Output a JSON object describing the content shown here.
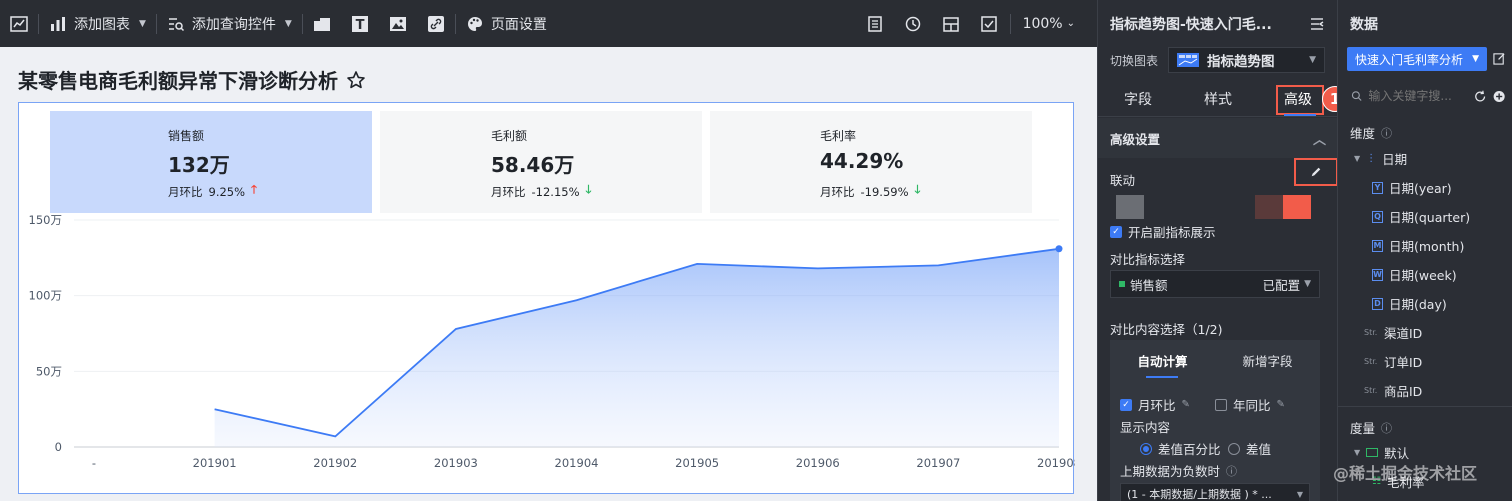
{
  "toolbar": {
    "add_chart": "添加图表",
    "add_query": "添加查询控件",
    "page_settings": "页面设置",
    "zoom": "100%"
  },
  "dashboard": {
    "title": "某零售电商毛利额异常下滑诊断分析",
    "kpis": [
      {
        "title": "销售额",
        "value": "132万",
        "cmp_label": "月环比",
        "cmp_value": "9.25%",
        "direction": "up"
      },
      {
        "title": "毛利额",
        "value": "58.46万",
        "cmp_label": "月环比",
        "cmp_value": "-12.15%",
        "direction": "down"
      },
      {
        "title": "毛利率",
        "value": "44.29%",
        "cmp_label": "月环比",
        "cmp_value": "-19.59%",
        "direction": "down"
      }
    ],
    "chart_data": {
      "type": "area",
      "categories": [
        "-",
        "201901",
        "201902",
        "201903",
        "201904",
        "201905",
        "201906",
        "201907",
        "201908"
      ],
      "x": [
        "201901",
        "201902",
        "201903",
        "201904",
        "201905",
        "201906",
        "201907",
        "201908"
      ],
      "values": [
        25,
        7,
        78,
        97,
        121,
        118,
        120,
        131
      ],
      "yticks": [
        "0",
        "50万",
        "100万",
        "150万"
      ],
      "ylim": [
        0,
        150
      ],
      "y_unit": "万",
      "color": "#3d7bf5"
    }
  },
  "settings": {
    "header": "指标趋势图-快速入门毛...",
    "switch_label": "切换图表",
    "switch_value": "指标趋势图",
    "tabs": [
      "字段",
      "样式",
      "高级"
    ],
    "advanced_title": "高级设置",
    "linkage": "联动",
    "badge1": "1",
    "badge2": "2",
    "enable_sub": "开启副指标展示",
    "metric_select_label": "对比指标选择",
    "metric_value": "销售额",
    "metric_status": "已配置",
    "content_select_label": "对比内容选择（1/2)",
    "cmp_tabs": [
      "自动计算",
      "新增字段"
    ],
    "mom": "月环比",
    "yoy": "年同比",
    "display_content": "显示内容",
    "diff_pct": "差值百分比",
    "diff": "差值",
    "negative_label": "上期数据为负数时",
    "formula": "(1 - 本期数据/上期数据 ) * ..."
  },
  "data_panel": {
    "title": "数据",
    "dataset": "快速入门毛利率分析",
    "search_placeholder": "输入关键字搜...",
    "dimension_title": "维度",
    "date_group": "日期",
    "date_fields": [
      {
        "tag": "Y",
        "label": "日期(year)"
      },
      {
        "tag": "Q",
        "label": "日期(quarter)"
      },
      {
        "tag": "M",
        "label": "日期(month)"
      },
      {
        "tag": "W",
        "label": "日期(week)"
      },
      {
        "tag": "D",
        "label": "日期(day)"
      }
    ],
    "str_fields": [
      "渠道ID",
      "订单ID",
      "商品ID"
    ],
    "str_tag": "Str.",
    "measure_title": "度量",
    "measure_group": "默认",
    "measure_field": "毛利率"
  },
  "watermark": "@稀土掘金技术社区"
}
